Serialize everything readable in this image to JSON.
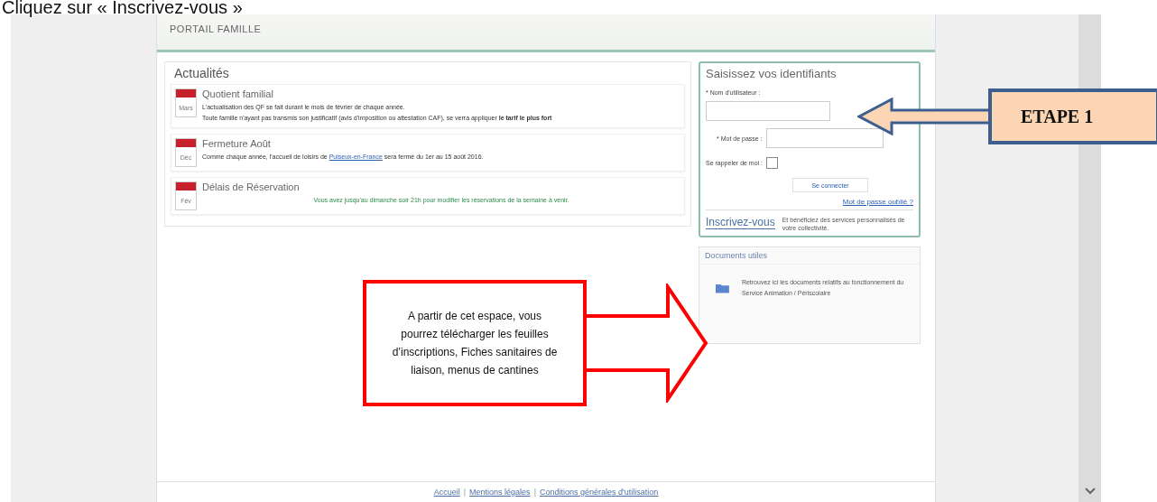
{
  "instruction": "Cliquez sur « Inscrivez-vous »",
  "portal": {
    "title": "PORTAIL FAMILLE",
    "news": {
      "title": "Actualités",
      "items": [
        {
          "month": "Mars",
          "title": "Quotient familial",
          "paragraphs": [
            {
              "kind": "text",
              "before": "L'actualisation des QF se fait durant le mois de février de chaque année."
            },
            {
              "kind": "text",
              "before": "Toute famille n'ayant pas transmis son justificatif (avis d'imposition ou attestation CAF), se verra appliquer **le tarif le plus fort**"
            }
          ]
        },
        {
          "month": "Déc",
          "title": "Fermeture Août",
          "paragraphs": [
            {
              "kind": "text",
              "before": "Comme chaque année, l'accueil de loisirs de",
              "link": "Puiseux-en-France",
              "after": "sera fermé du 1er au 15 août 2016."
            }
          ]
        },
        {
          "month": "Fév",
          "title": "Délais de Réservation",
          "paragraphs": [
            {
              "kind": "notice",
              "before": "Vous avez jusqu'au dimanche soir 21h pour modifier les réservations de la semaine à venir."
            }
          ]
        }
      ]
    },
    "login": {
      "title": "Saisissez vos identifiants",
      "username_label": "* Nom d'utilisateur :",
      "password_label": "* Mot de passe :",
      "remember_label": "Se rappeler de moi :",
      "remember_checked": false,
      "submit": "Se connecter",
      "forgot": "Mot de passe oublié ?",
      "register": "Inscrivez-vous",
      "register_note": "Et bénéficiez des services personnalisés de votre collectivité."
    },
    "documents": {
      "title": "Documents utiles",
      "text": "Retrouvez ici les documents relatifs au fonctionnement du Service Animation / Périscolaire"
    },
    "footer": {
      "separator": "|",
      "links": [
        "Accueil",
        "Mentions légales",
        "Conditions générales d'utilisation"
      ]
    }
  },
  "annotations": {
    "step": "ETAPE 1",
    "note": "A partir de cet espace, vous pourrez télécharger les feuilles d’inscriptions, Fiches sanitaires de liaison, menus de cantines"
  }
}
